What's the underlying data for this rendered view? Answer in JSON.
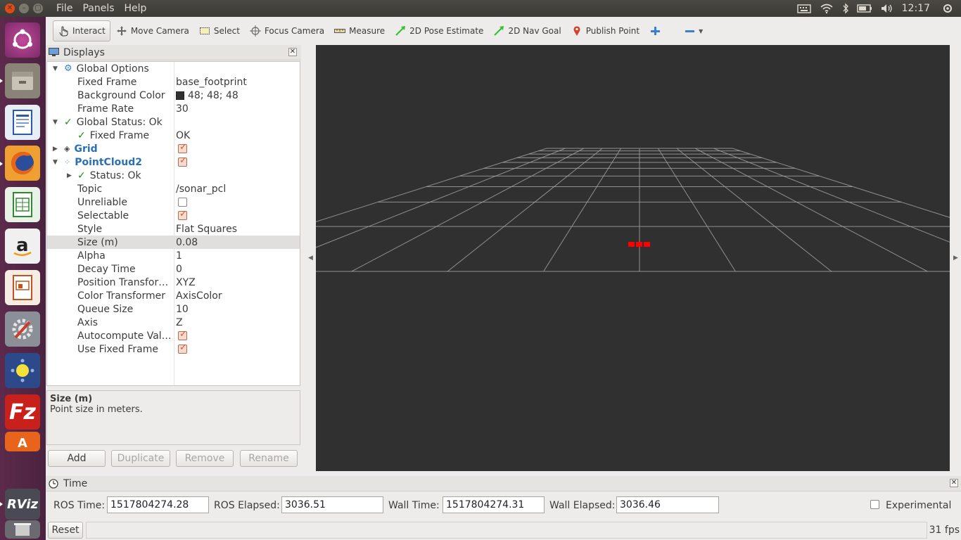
{
  "topbar": {
    "menus": [
      "File",
      "Panels",
      "Help"
    ],
    "clock": "12:17"
  },
  "toolbar": {
    "tools": [
      {
        "label": "Interact",
        "icon": "hand-pointer-icon"
      },
      {
        "label": "Move Camera",
        "icon": "move-arrows-icon"
      },
      {
        "label": "Select",
        "icon": "select-rectangle-icon"
      },
      {
        "label": "Focus Camera",
        "icon": "crosshair-icon"
      },
      {
        "label": "Measure",
        "icon": "ruler-icon"
      },
      {
        "label": "2D Pose Estimate",
        "icon": "green-arrow-icon"
      },
      {
        "label": "2D Nav Goal",
        "icon": "green-arrow-icon"
      },
      {
        "label": "Publish Point",
        "icon": "map-pin-icon"
      }
    ]
  },
  "displays": {
    "title": "Displays",
    "global_options": {
      "label": "Global Options",
      "fixed_frame_label": "Fixed Frame",
      "fixed_frame_value": "base_footprint",
      "background_color_label": "Background Color",
      "background_color_value": "48; 48; 48",
      "frame_rate_label": "Frame Rate",
      "frame_rate_value": "30"
    },
    "global_status": {
      "label": "Global Status: Ok",
      "fixed_frame_label": "Fixed Frame",
      "fixed_frame_value": "OK"
    },
    "grid": {
      "label": "Grid"
    },
    "pointcloud2": {
      "label": "PointCloud2",
      "status_label": "Status: Ok",
      "properties": [
        {
          "name": "Topic",
          "value": "/sonar_pcl"
        },
        {
          "name": "Unreliable",
          "value": ""
        },
        {
          "name": "Selectable",
          "value": ""
        },
        {
          "name": "Style",
          "value": "Flat Squares"
        },
        {
          "name": "Size (m)",
          "value": "0.08"
        },
        {
          "name": "Alpha",
          "value": "1"
        },
        {
          "name": "Decay Time",
          "value": "0"
        },
        {
          "name": "Position Transfor…",
          "value": "XYZ"
        },
        {
          "name": "Color Transformer",
          "value": "AxisColor"
        },
        {
          "name": "Queue Size",
          "value": "10"
        },
        {
          "name": "Axis",
          "value": "Z"
        },
        {
          "name": "Autocompute Val…",
          "value": ""
        },
        {
          "name": "Use Fixed Frame",
          "value": ""
        }
      ]
    },
    "description": {
      "title": "Size (m)",
      "text": "Point size in meters."
    },
    "buttons": {
      "add": "Add",
      "duplicate": "Duplicate",
      "remove": "Remove",
      "rename": "Rename"
    }
  },
  "colors": {
    "background": "#303030",
    "point": "#ff0000",
    "grid": "#a0a0a0"
  },
  "time": {
    "title": "Time",
    "ros_time_label": "ROS Time:",
    "ros_time_value": "1517804274.28",
    "ros_elapsed_label": "ROS Elapsed:",
    "ros_elapsed_value": "3036.51",
    "wall_time_label": "Wall Time:",
    "wall_time_value": "1517804274.31",
    "wall_elapsed_label": "Wall Elapsed:",
    "wall_elapsed_value": "3036.46",
    "experimental_label": "Experimental"
  },
  "status": {
    "reset_label": "Reset",
    "fps": "31 fps"
  },
  "launcher": {
    "rviz_label": "RViz"
  }
}
